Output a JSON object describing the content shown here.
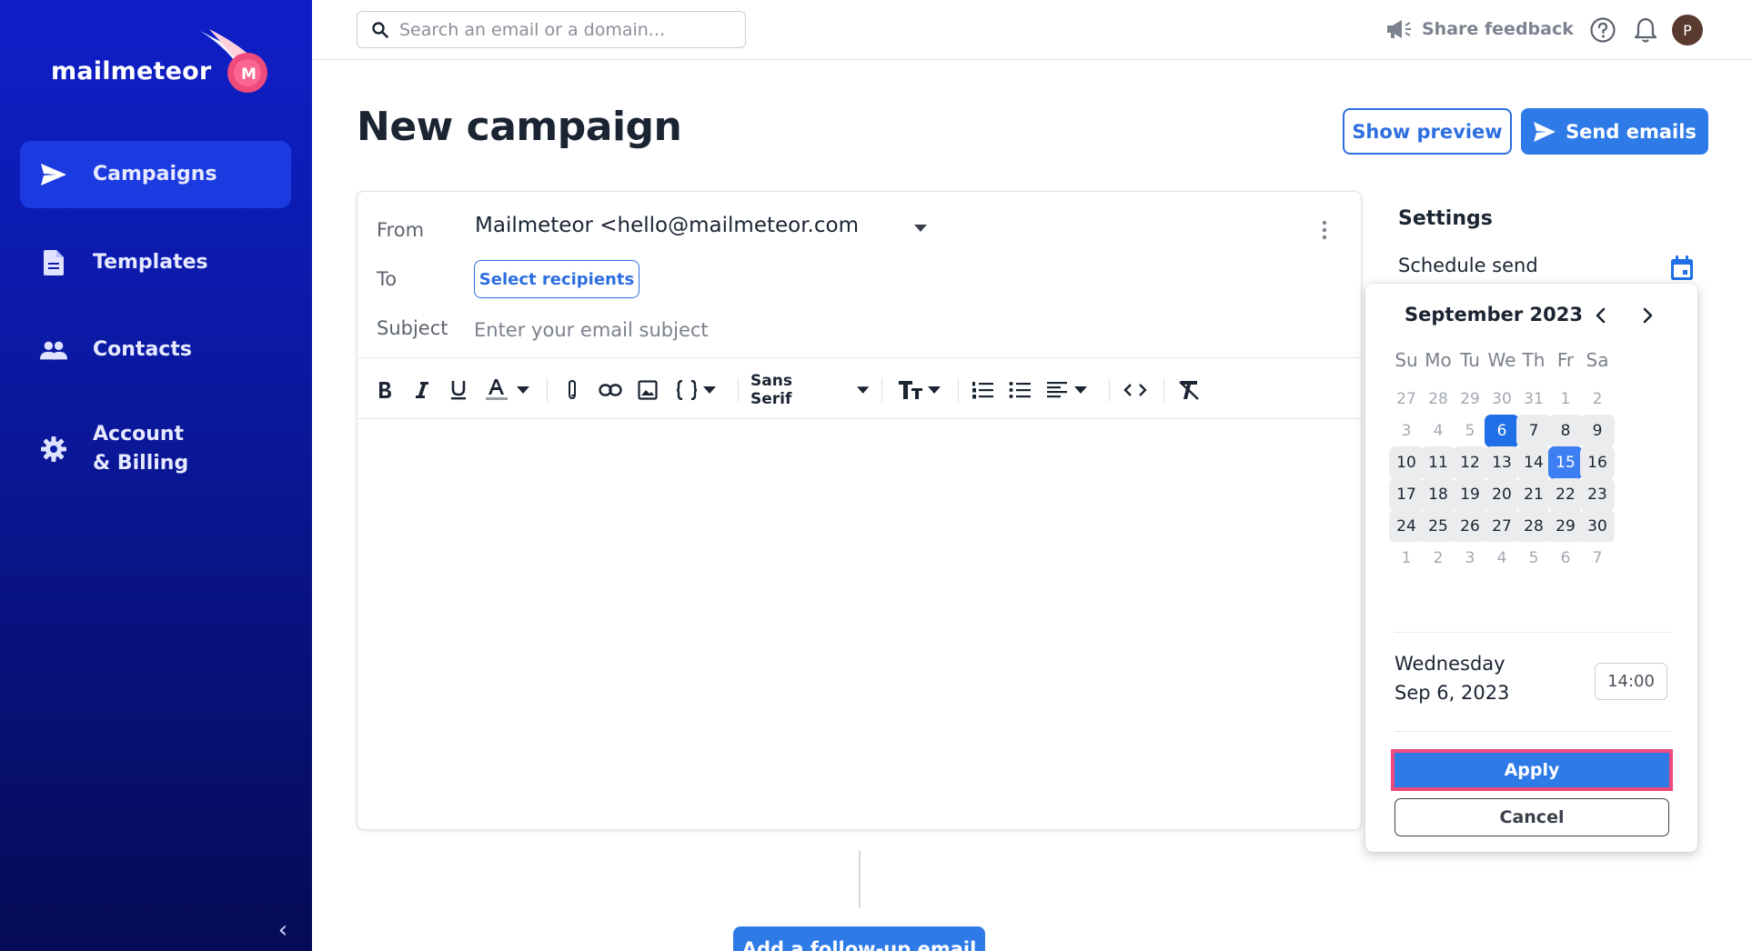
{
  "brand": {
    "name": "mailmeteor",
    "logo_letter": "M"
  },
  "sidebar": {
    "items": [
      {
        "label": "Campaigns",
        "icon": "send-icon",
        "active": true
      },
      {
        "label": "Templates",
        "icon": "document-icon",
        "active": false
      },
      {
        "label": "Contacts",
        "icon": "people-icon",
        "active": false
      },
      {
        "label": "Account\n& Billing",
        "icon": "gear-icon",
        "active": false
      }
    ],
    "collapse_glyph": "‹"
  },
  "topbar": {
    "search_placeholder": "Search an email or a domain...",
    "feedback_label": "Share feedback",
    "avatar_initial": "P"
  },
  "page": {
    "title": "New campaign",
    "preview_label": "Show preview",
    "send_label": "Send emails"
  },
  "editor": {
    "from_label": "From",
    "from_value": "Mailmeteor <hello@mailmeteor.com",
    "to_label": "To",
    "recipients_label": "Select recipients",
    "subject_label": "Subject",
    "subject_placeholder": "Enter your email subject",
    "font_name": "Sans Serif"
  },
  "followup_label": "Add a follow-up email",
  "settings": {
    "title": "Settings",
    "schedule_label": "Schedule send"
  },
  "calendar": {
    "month_label": "September 2023",
    "weekdays": [
      "Su",
      "Mo",
      "Tu",
      "We",
      "Th",
      "Fr",
      "Sa"
    ],
    "weeks": [
      [
        {
          "d": "27",
          "s": "out"
        },
        {
          "d": "28",
          "s": "out"
        },
        {
          "d": "29",
          "s": "out"
        },
        {
          "d": "30",
          "s": "out"
        },
        {
          "d": "31",
          "s": "out"
        },
        {
          "d": "1",
          "s": "past"
        },
        {
          "d": "2",
          "s": "past"
        }
      ],
      [
        {
          "d": "3",
          "s": "past"
        },
        {
          "d": "4",
          "s": "past"
        },
        {
          "d": "5",
          "s": "past"
        },
        {
          "d": "6",
          "s": "selected"
        },
        {
          "d": "7",
          "s": "day"
        },
        {
          "d": "8",
          "s": "day"
        },
        {
          "d": "9",
          "s": "day"
        }
      ],
      [
        {
          "d": "10",
          "s": "day"
        },
        {
          "d": "11",
          "s": "day"
        },
        {
          "d": "12",
          "s": "day"
        },
        {
          "d": "13",
          "s": "day"
        },
        {
          "d": "14",
          "s": "day"
        },
        {
          "d": "15",
          "s": "today"
        },
        {
          "d": "16",
          "s": "day"
        }
      ],
      [
        {
          "d": "17",
          "s": "day"
        },
        {
          "d": "18",
          "s": "day"
        },
        {
          "d": "19",
          "s": "day"
        },
        {
          "d": "20",
          "s": "day"
        },
        {
          "d": "21",
          "s": "day"
        },
        {
          "d": "22",
          "s": "day"
        },
        {
          "d": "23",
          "s": "day"
        }
      ],
      [
        {
          "d": "24",
          "s": "day"
        },
        {
          "d": "25",
          "s": "day"
        },
        {
          "d": "26",
          "s": "day"
        },
        {
          "d": "27",
          "s": "day"
        },
        {
          "d": "28",
          "s": "day"
        },
        {
          "d": "29",
          "s": "day"
        },
        {
          "d": "30",
          "s": "day"
        }
      ],
      [
        {
          "d": "1",
          "s": "out"
        },
        {
          "d": "2",
          "s": "out"
        },
        {
          "d": "3",
          "s": "out"
        },
        {
          "d": "4",
          "s": "out"
        },
        {
          "d": "5",
          "s": "out"
        },
        {
          "d": "6",
          "s": "out"
        },
        {
          "d": "7",
          "s": "out"
        }
      ]
    ],
    "selected_weekday": "Wednesday",
    "selected_date": "Sep 6, 2023",
    "time_value": "14:00",
    "apply_label": "Apply",
    "cancel_label": "Cancel"
  },
  "colors": {
    "accent": "#2e7be8",
    "sidebar_active": "#1b3be0",
    "highlight": "#ef4a7c"
  }
}
